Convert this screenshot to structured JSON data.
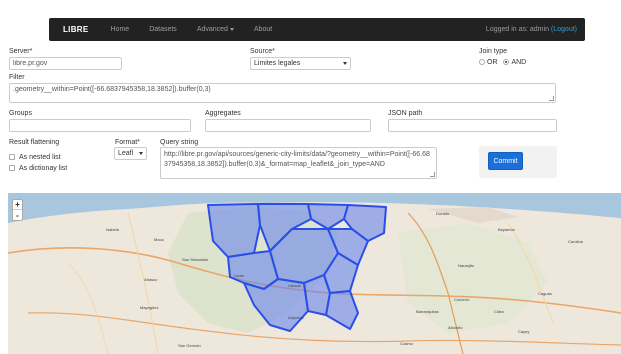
{
  "navbar": {
    "brand": "LIBRE",
    "items": [
      "Home",
      "Datasets",
      "Advanced",
      "About"
    ],
    "login_text": "Logged in as: admin",
    "logout_label": "(Logout)"
  },
  "form": {
    "server_label": "Server*",
    "server_value": "libre.pr.gov",
    "source_label": "Source*",
    "source_value": "Limites legales",
    "join_type_label": "Join type",
    "join_or": "OR",
    "join_and": "AND",
    "join_selected": "AND",
    "filter_label": "Filter",
    "filter_value": ".geometry__within=Point([-66.6837945358,18.3852]).buffer(0,3)",
    "groups_label": "Groups",
    "aggregates_label": "Aggregates",
    "json_path_label": "JSON path",
    "result_flattening_label": "Result flattening",
    "nested_list_label": "As nested list",
    "dictionary_list_label": "As dictionay list",
    "format_label": "Format*",
    "format_value": "Leafl",
    "query_string_label": "Query string",
    "query_string_value": "http://libre.pr.gov/api/sources/generic-city-limits/data/?geometry__within=Point([-66.6837945358,18.3852]).buffer(0.3)&_format=map_leaflet&_join_type=AND",
    "commit_label": "Commit"
  },
  "map": {
    "zoom_in": "+",
    "zoom_out": "-",
    "labels": [
      {
        "id": "moca",
        "text": "Moca"
      },
      {
        "id": "isabela",
        "text": "Isabela"
      },
      {
        "id": "san-sebastian",
        "text": "San Sebastián"
      },
      {
        "id": "anasco",
        "text": "Añasco"
      },
      {
        "id": "mayaguez",
        "text": "Mayagüez"
      },
      {
        "id": "lares",
        "text": "Lares"
      },
      {
        "id": "utuado",
        "text": "Utuado"
      },
      {
        "id": "adjuntas",
        "text": "Adjuntas"
      },
      {
        "id": "dorado",
        "text": "Dorado"
      },
      {
        "id": "bayamon",
        "text": "Bayamón"
      },
      {
        "id": "carolina",
        "text": "Carolina"
      },
      {
        "id": "caguas",
        "text": "Caguas"
      },
      {
        "id": "comerio",
        "text": "Comerío"
      },
      {
        "id": "barranquitas",
        "text": "Barranquitas"
      },
      {
        "id": "cidra",
        "text": "Cidra"
      },
      {
        "id": "cayey",
        "text": "Cayey"
      },
      {
        "id": "aibonito",
        "text": "Aibonito"
      },
      {
        "id": "naranjito",
        "text": "Naranjito"
      },
      {
        "id": "coamo",
        "text": "Coamo"
      },
      {
        "id": "san-german",
        "text": "San Germán"
      }
    ],
    "colors": {
      "water": "#a8c6dd",
      "land": "#ede7dc",
      "highlight_fill": "#5f7ef0",
      "highlight_stroke": "#2a4ee8"
    }
  }
}
